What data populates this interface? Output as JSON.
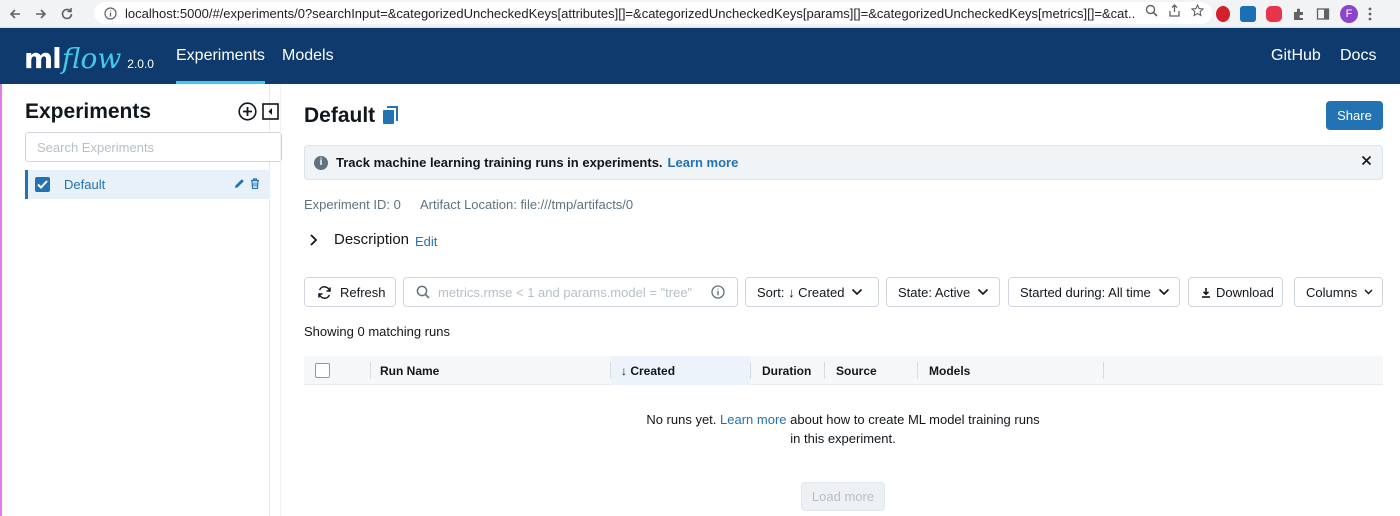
{
  "browser": {
    "url": "localhost:5000/#/experiments/0?searchInput=&categorizedUncheckedKeys[attributes][]=&categorizedUncheckedKeys[params][]=&categorizedUncheckedKeys[metrics][]=&cat...",
    "profile_initial": "F"
  },
  "header": {
    "logo_ml": "ml",
    "logo_flow": "flow",
    "version": "2.0.0",
    "nav": [
      "Experiments",
      "Models"
    ],
    "right_links": [
      "GitHub",
      "Docs"
    ],
    "bg_color": "#0e3a6e",
    "accent": "#43c9ed"
  },
  "sidebar": {
    "title": "Experiments",
    "search_placeholder": "Search Experiments",
    "items": [
      {
        "label": "Default",
        "checked": true
      }
    ]
  },
  "experiment": {
    "title": "Default",
    "share_label": "Share",
    "banner_text": "Track machine learning training runs in experiments.",
    "banner_link": "Learn more",
    "experiment_id": "Experiment ID: 0",
    "artifact_location": "Artifact Location: file:///tmp/artifacts/0",
    "description_label": "Description",
    "description_edit": "Edit"
  },
  "toolbar": {
    "refresh": "Refresh",
    "search_placeholder": "metrics.rmse < 1 and params.model = \"tree\"",
    "sort": "Sort: ↓ Created",
    "state": "State: Active",
    "started": "Started during: All time",
    "download": "Download",
    "columns": "Columns"
  },
  "runs": {
    "showing": "Showing 0 matching runs",
    "columns": [
      "Run Name",
      "↓ Created",
      "Duration",
      "Source",
      "Models"
    ],
    "empty_pre": "No runs yet.",
    "empty_link": "Learn more",
    "empty_post": "about how to create ML model training runs in this experiment.",
    "load_more": "Load more"
  }
}
